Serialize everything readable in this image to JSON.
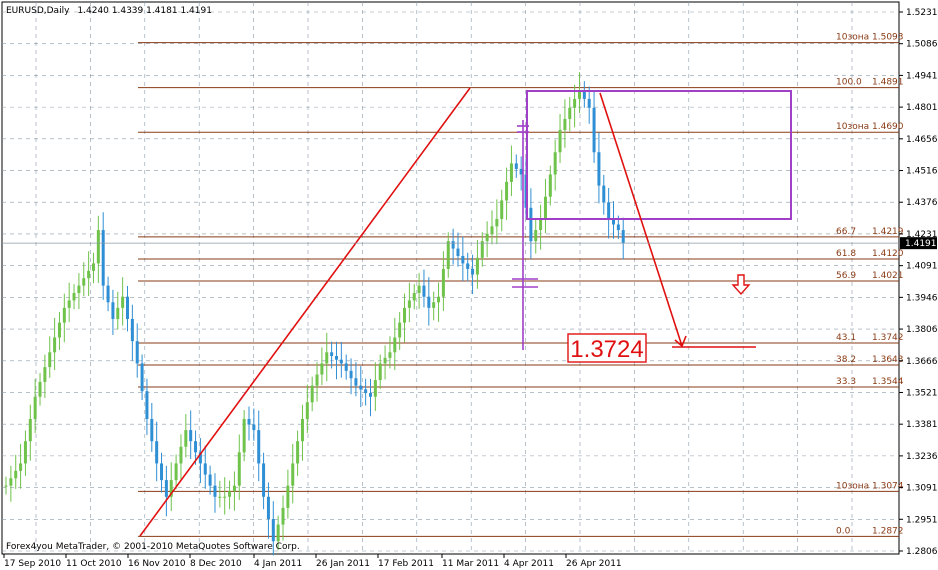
{
  "header": {
    "symbol": "EURUSD,Daily",
    "ohlc": "1.4240 1.4339 1.4181 1.4191"
  },
  "footer": {
    "copyright": "Forex4you MetaTrader, © 2001-2010 MetaQuotes Software Corp."
  },
  "annotation": {
    "target_price": "1.3724"
  },
  "chart_data": {
    "type": "candlestick",
    "ylim": [
      1.2806,
      1.5231
    ],
    "grid": true,
    "y_tick_labels": [
      "1.5231",
      "1.5086",
      "1.4941",
      "1.4801",
      "1.4656",
      "1.4516",
      "1.4376",
      "1.4231",
      "1.4091",
      "1.3946",
      "1.3806",
      "1.3666",
      "1.3521",
      "1.3381",
      "1.3236",
      "1.3091",
      "1.2951",
      "1.2806"
    ],
    "current_price": "1.4191",
    "x_tick_labels": [
      "17 Sep 2010",
      "11 Oct 2010",
      "16 Nov 2010",
      "8 Dec 2010",
      "4 Jan 2011",
      "26 Jan 2011",
      "17 Feb 2011",
      "11 Mar 2011",
      "4 Apr 2011",
      "26 Apr 2011"
    ],
    "levels": [
      {
        "label": "10зона",
        "value": "1.5093",
        "price": 1.5093
      },
      {
        "label": "100.0",
        "value": "1.4891",
        "price": 1.4891
      },
      {
        "label": "10зона",
        "value": "1.4690",
        "price": 1.469
      },
      {
        "label": "66.7",
        "value": "1.4219",
        "price": 1.4219
      },
      {
        "label": "61.8",
        "value": "1.4120",
        "price": 1.412
      },
      {
        "label": "56.9",
        "value": "1.4021",
        "price": 1.4021
      },
      {
        "label": "43.1",
        "value": "1.3742",
        "price": 1.3742
      },
      {
        "label": "38.2",
        "value": "1.3643",
        "price": 1.3643
      },
      {
        "label": "33.3",
        "value": "1.3544",
        "price": 1.3544
      },
      {
        "label": "10зона",
        "value": "1.3074",
        "price": 1.3074
      },
      {
        "label": "0.0",
        "value": "1.2872",
        "price": 1.2872
      }
    ],
    "price_path": [
      [
        0,
        1.31
      ],
      [
        3,
        1.32
      ],
      [
        6,
        1.35
      ],
      [
        9,
        1.37
      ],
      [
        12,
        1.39
      ],
      [
        15,
        1.4
      ],
      [
        18,
        1.41
      ],
      [
        19,
        1.425
      ],
      [
        20,
        1.4
      ],
      [
        22,
        1.385
      ],
      [
        24,
        1.395
      ],
      [
        27,
        1.365
      ],
      [
        29,
        1.34
      ],
      [
        31,
        1.32
      ],
      [
        33,
        1.305
      ],
      [
        35,
        1.32
      ],
      [
        37,
        1.335
      ],
      [
        39,
        1.325
      ],
      [
        41,
        1.315
      ],
      [
        43,
        1.305
      ],
      [
        45,
        1.305
      ],
      [
        47,
        1.31
      ],
      [
        49,
        1.34
      ],
      [
        51,
        1.335
      ],
      [
        53,
        1.305
      ],
      [
        55,
        1.285
      ],
      [
        57,
        1.3
      ],
      [
        59,
        1.32
      ],
      [
        61,
        1.34
      ],
      [
        63,
        1.355
      ],
      [
        66,
        1.37
      ],
      [
        69,
        1.365
      ],
      [
        72,
        1.355
      ],
      [
        75,
        1.35
      ],
      [
        77,
        1.365
      ],
      [
        79,
        1.37
      ],
      [
        82,
        1.39
      ],
      [
        85,
        1.4
      ],
      [
        87,
        1.39
      ],
      [
        89,
        1.395
      ],
      [
        91,
        1.42
      ],
      [
        94,
        1.41
      ],
      [
        96,
        1.405
      ],
      [
        98,
        1.42
      ],
      [
        101,
        1.43
      ],
      [
        104,
        1.455
      ],
      [
        106,
        1.45
      ],
      [
        108,
        1.42
      ],
      [
        110,
        1.43
      ],
      [
        112,
        1.45
      ],
      [
        114,
        1.47
      ],
      [
        116,
        1.48
      ],
      [
        118,
        1.488
      ],
      [
        120,
        1.48
      ],
      [
        121,
        1.46
      ],
      [
        122,
        1.445
      ],
      [
        124,
        1.43
      ],
      [
        126,
        1.425
      ],
      [
        127,
        1.419
      ]
    ]
  }
}
